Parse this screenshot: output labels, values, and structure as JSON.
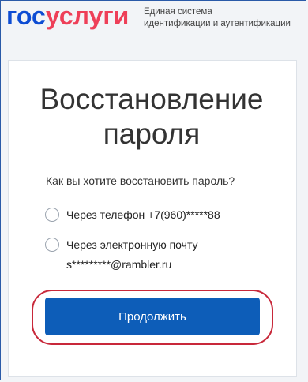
{
  "header": {
    "logo_part1": "гос",
    "logo_part2": "услуги",
    "subtitle_line1": "Единая система",
    "subtitle_line2": "идентификации и аутентификации"
  },
  "form": {
    "title_line1": "Восстановление",
    "title_line2": "пароля",
    "question": "Как вы хотите восстановить пароль?",
    "options": [
      {
        "label": "Через телефон +7(960)*****88",
        "selected": false
      },
      {
        "label_line1": "Через электронную почту",
        "label_line2": "s*********@rambler.ru",
        "selected": false
      }
    ],
    "submit_label": "Продолжить"
  },
  "colors": {
    "brand_blue": "#0d4cd3",
    "brand_red": "#ee3f58",
    "button_blue": "#0d5db8",
    "annotation_red": "#c8283a"
  }
}
